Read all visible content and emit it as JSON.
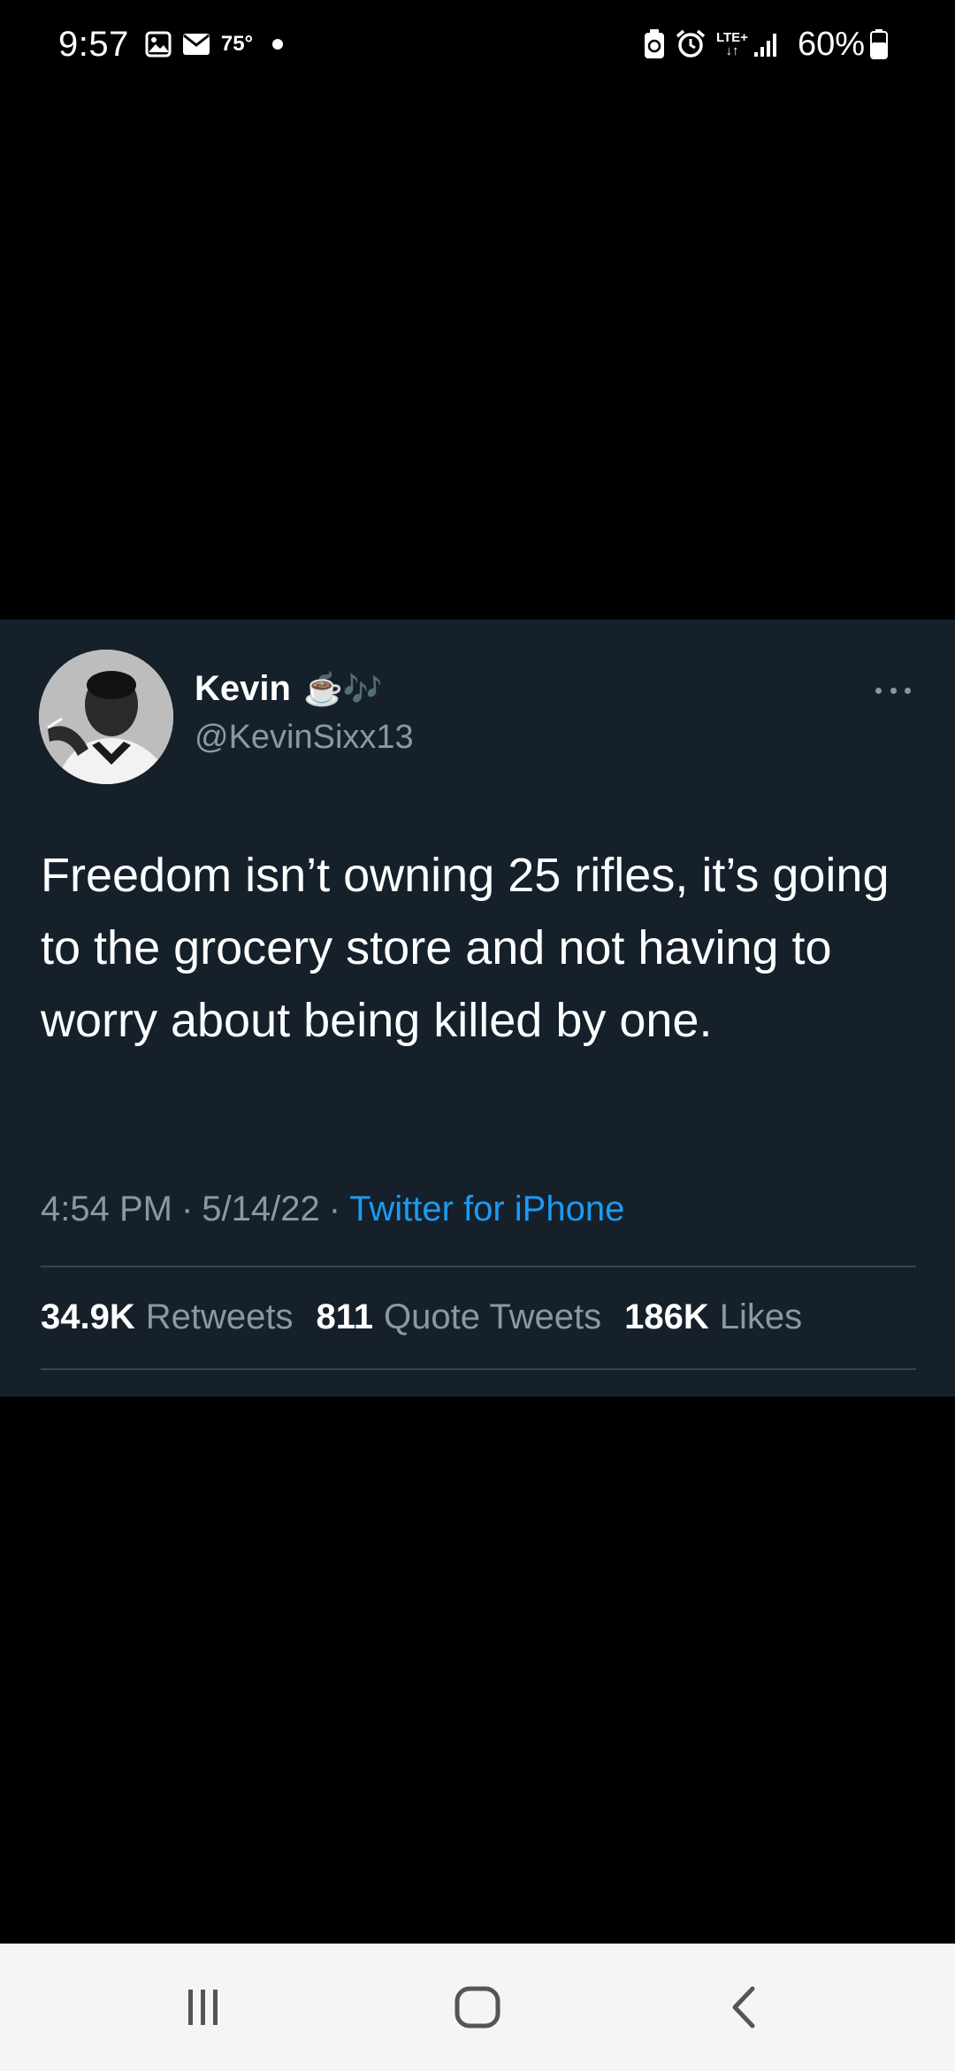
{
  "status_bar": {
    "time": "9:57",
    "temperature": "75°",
    "network": "LTE+",
    "battery": "60%"
  },
  "tweet": {
    "author_name": "Kevin",
    "author_emoji": "☕🎶",
    "handle": "@KevinSixx13",
    "text": "Freedom isn’t owning 25 rifles, it’s going to the grocery store and not having to worry about being killed by one.",
    "time": "4:54 PM",
    "date": "5/14/22",
    "separator": "·",
    "source": "Twitter for iPhone",
    "stats": {
      "retweets_count": "34.9K",
      "retweets_label": "Retweets",
      "quotes_count": "811",
      "quotes_label": "Quote Tweets",
      "likes_count": "186K",
      "likes_label": "Likes"
    }
  },
  "colors": {
    "card_background": "#15202b",
    "secondary_text": "#8899a6",
    "link": "#1d9bf0",
    "divider": "#38444d",
    "nav_background": "#f5f5f5"
  },
  "icons": {
    "status": [
      "gallery-icon",
      "mail-icon",
      "battery-saver-icon",
      "alarm-icon",
      "signal-icon",
      "battery-icon"
    ],
    "nav": [
      "recent-apps-icon",
      "home-icon",
      "back-icon"
    ],
    "tweet": [
      "more-icon"
    ]
  }
}
